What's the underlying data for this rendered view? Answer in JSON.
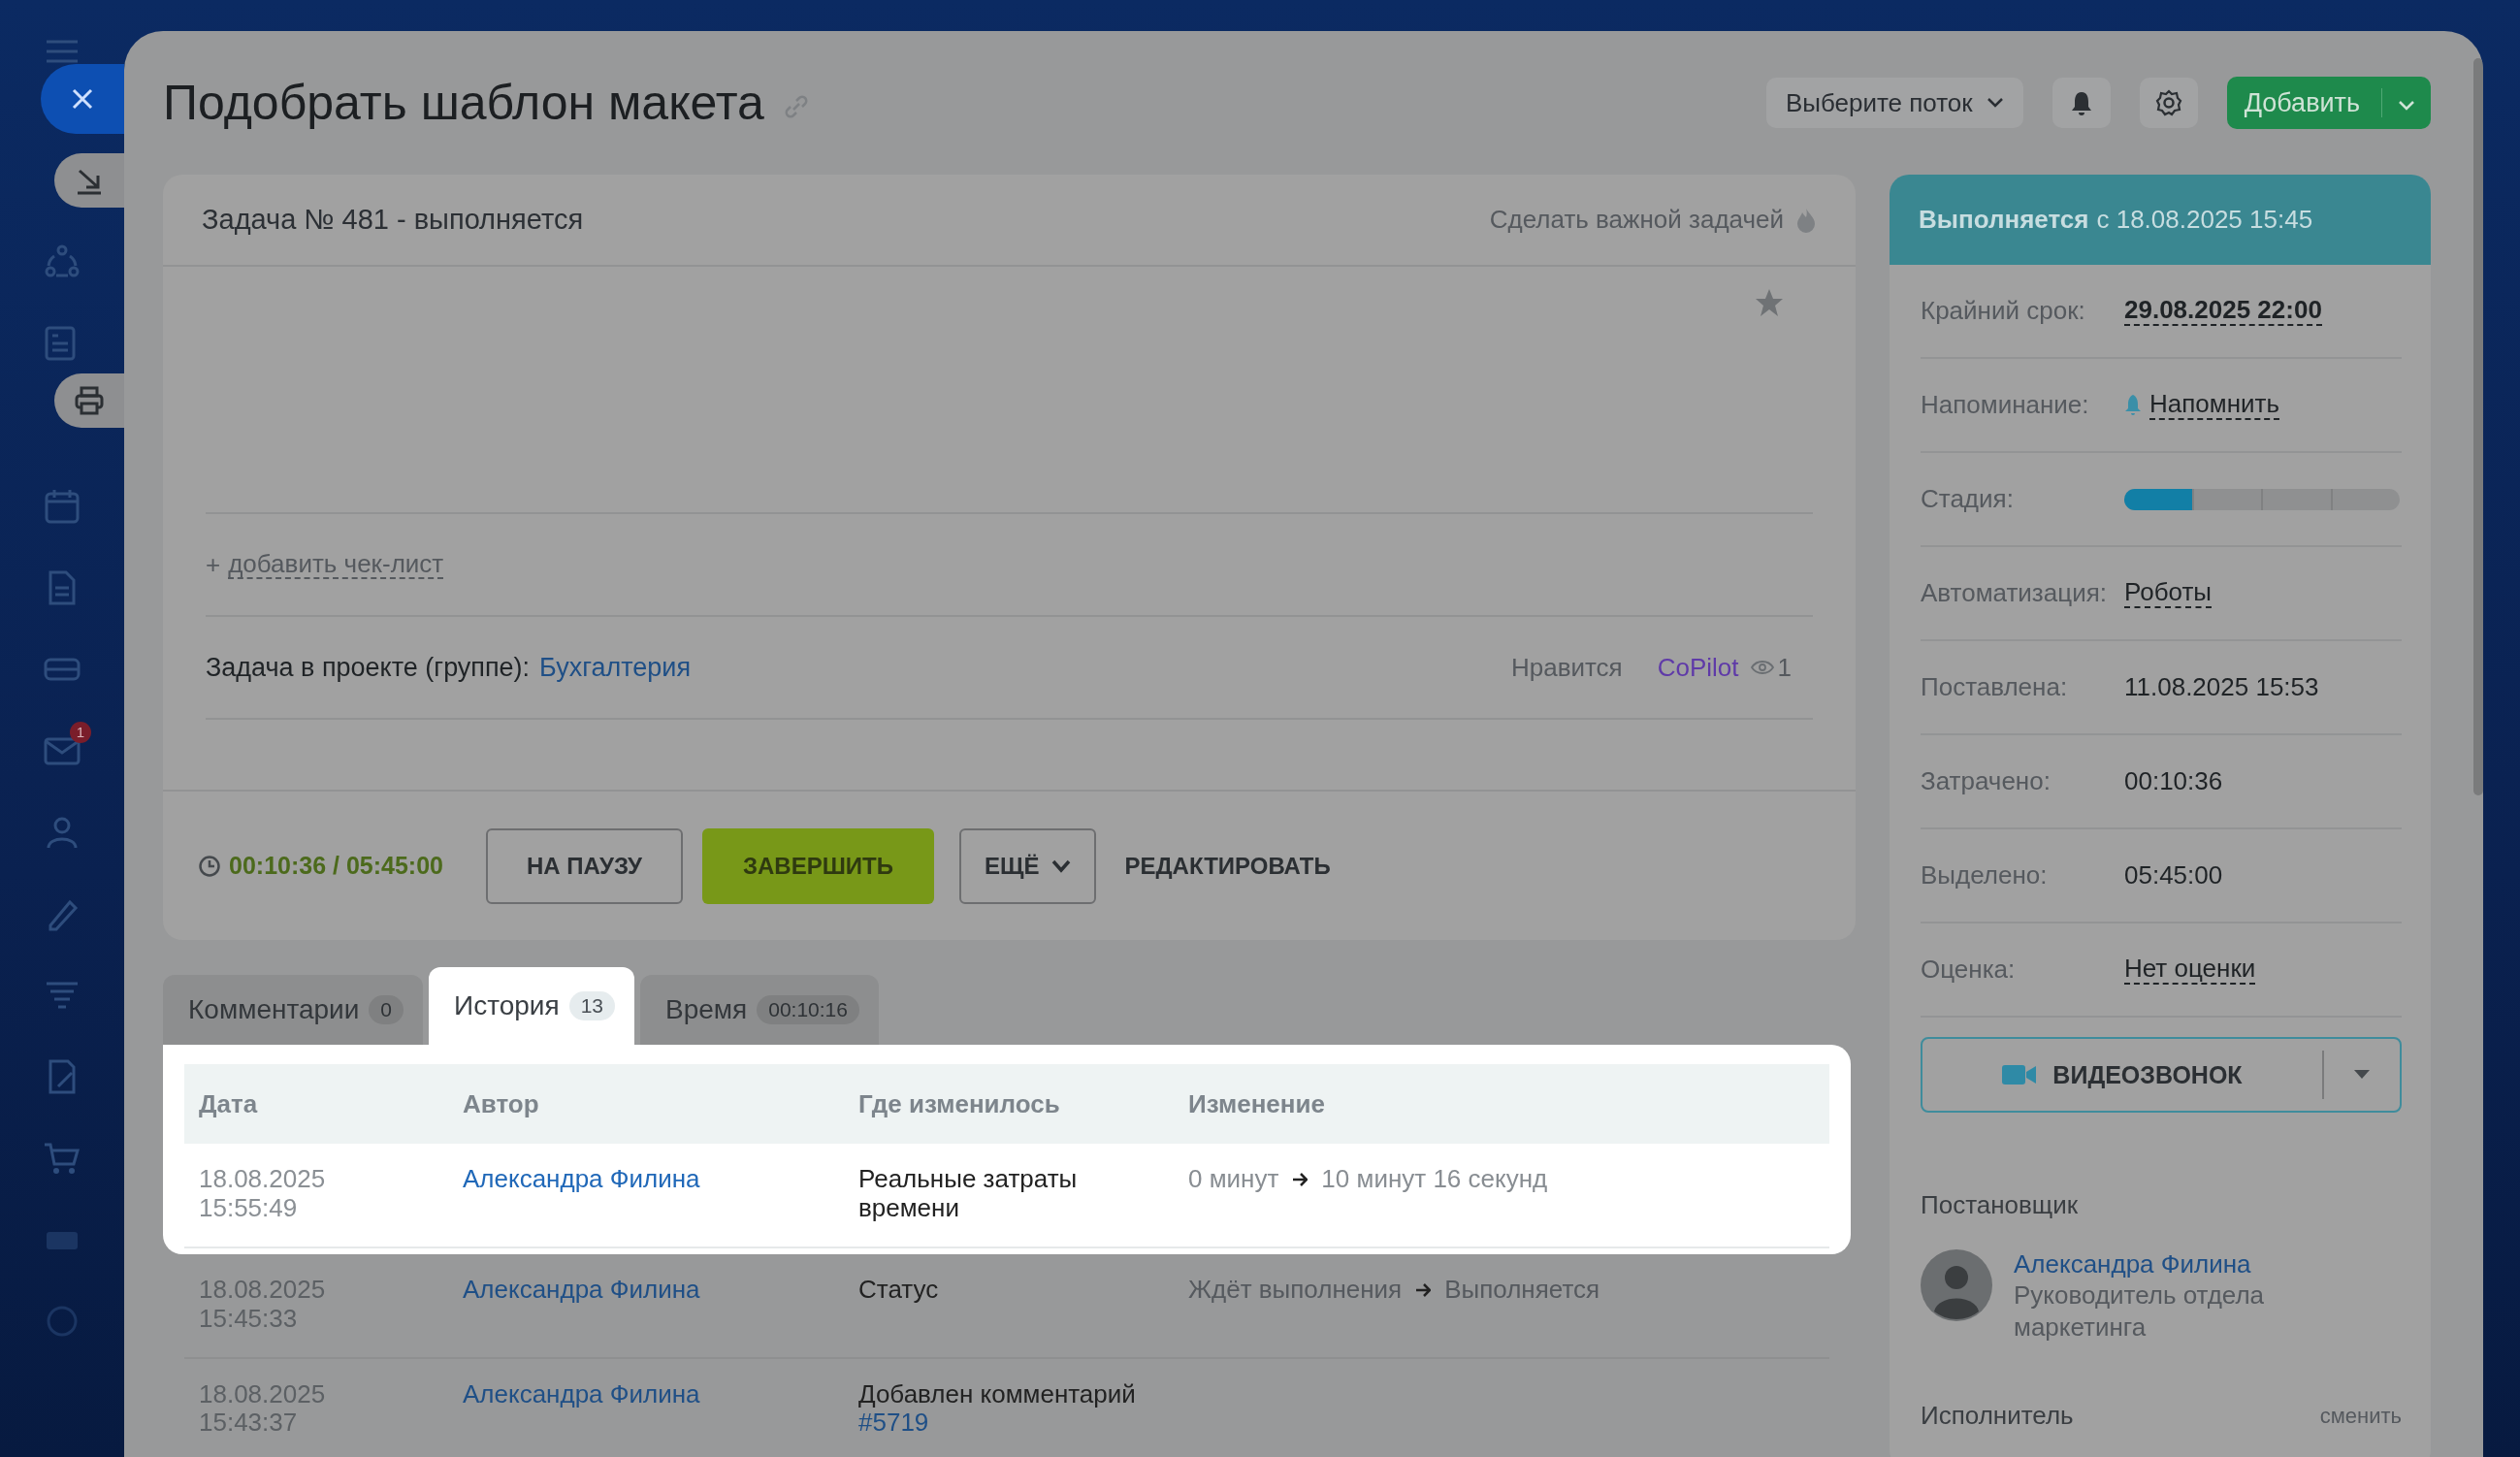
{
  "sidebar": {
    "mail_badge": "1"
  },
  "title": "Подобрать шаблон макета",
  "header": {
    "flow_select": "Выберите поток",
    "add_button": "Добавить"
  },
  "task": {
    "heading": "Задача № 481 - выполняется",
    "important_link": "Сделать важной задачей",
    "checklist_prefix": "+",
    "checklist_link": "добавить чек-лист",
    "project_label": "Задача в проекте (группе):",
    "project": "Бухгалтерия",
    "like": "Нравится",
    "copilot": "CoPilot",
    "views": "1",
    "timer": "00:10:36 / 05:45:00",
    "buttons": [
      {
        "label": "НА ПАУЗУ",
        "kind": "outline"
      },
      {
        "label": "ЗАВЕРШИТЬ",
        "kind": "primary"
      },
      {
        "label": "ЕЩЁ",
        "kind": "dropdown"
      },
      {
        "label": "РЕДАКТИРОВАТЬ",
        "kind": "link"
      }
    ]
  },
  "tabs": [
    {
      "label": "Комментарии",
      "count": "0",
      "selected": false
    },
    {
      "label": "История",
      "count": "13",
      "selected": true
    },
    {
      "label": "Время",
      "count": "00:10:16",
      "selected": false
    }
  ],
  "history": {
    "columns": [
      "Дата",
      "Автор",
      "Где изменилось",
      "Изменение"
    ],
    "rows": [
      {
        "date": "18.08.2025",
        "time": "15:55:49",
        "author": "Александра Филина",
        "field": "Реальные затраты времени",
        "from": "0 минут",
        "to": "10 минут 16 секунд",
        "highlighted": true
      },
      {
        "date": "18.08.2025",
        "time": "15:45:33",
        "author": "Александра Филина",
        "field": "Статус",
        "from": "Ждёт выполнения",
        "to": "Выполняется",
        "highlighted": false
      },
      {
        "date": "18.08.2025",
        "time": "15:43:37",
        "author": "Александра Филина",
        "field": "Добавлен комментарий",
        "field_link": "#5719",
        "highlighted": false
      }
    ]
  },
  "status_panel": {
    "status": "Выполняется",
    "since": "с 18.08.2025 15:45",
    "fields": [
      {
        "label": "Крайний срок:",
        "value": "29.08.2025 22:00",
        "kind": "deadline"
      },
      {
        "label": "Напоминание:",
        "value": "Напомнить",
        "kind": "reminder"
      },
      {
        "label": "Стадия:",
        "kind": "stages",
        "stages": [
          {
            "done": true
          },
          {
            "done": false
          },
          {
            "done": false
          },
          {
            "done": false
          }
        ]
      },
      {
        "label": "Автоматизация:",
        "value": "Роботы",
        "kind": "link"
      },
      {
        "label": "Поставлена:",
        "value": "11.08.2025 15:53",
        "kind": "text"
      },
      {
        "label": "Затрачено:",
        "value": "00:10:36",
        "kind": "text"
      },
      {
        "label": "Выделено:",
        "value": "05:45:00",
        "kind": "text"
      },
      {
        "label": "Оценка:",
        "value": "Нет оценки",
        "kind": "link"
      }
    ],
    "video_button": "ВИДЕОЗВОНОК",
    "creator": {
      "heading": "Постановщик",
      "name": "Александра Филина",
      "role": "Руководитель отдела маркетинга"
    },
    "assignee": {
      "heading": "Исполнитель",
      "action": "сменить"
    }
  }
}
